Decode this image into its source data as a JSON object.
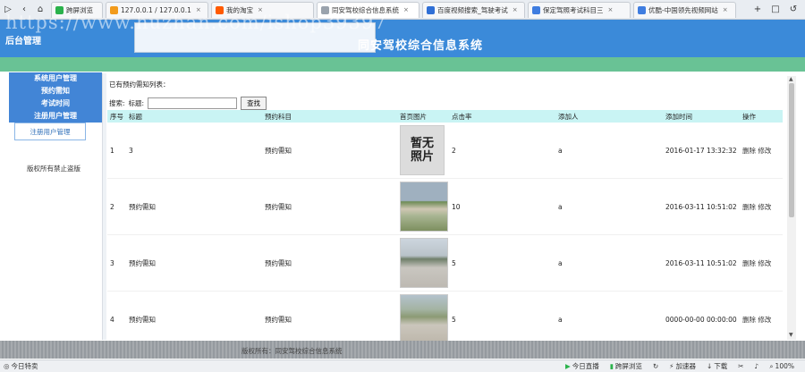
{
  "browser": {
    "tabs": [
      {
        "label": "跨屏浏览",
        "color": "#2bb24c",
        "active": false
      },
      {
        "label": "127.0.0.1 / 127.0.0.1",
        "color": "#f29b1c",
        "active": false
      },
      {
        "label": "我的淘宝",
        "color": "#ff5a00",
        "active": false
      },
      {
        "label": "同安驾校综合信息系统",
        "color": "#9aa3ad",
        "active": true
      },
      {
        "label": "百度视频搜索_驾驶考试",
        "color": "#2f6fd6",
        "active": false
      },
      {
        "label": "保定驾照考试科目三",
        "color": "#3f7de0",
        "active": false
      },
      {
        "label": "优酷-中国领先视频网站",
        "color": "#3f7de0",
        "active": false
      }
    ],
    "tools": [
      "+",
      "□",
      "↺"
    ]
  },
  "watermark": "https://www.huzhan.com/ishop39397",
  "header": {
    "admin_label": "后台管理",
    "system_title": "同安驾校综合信息系统"
  },
  "sidebar": {
    "main_items": [
      "系统用户管理",
      "预约需知",
      "考试时间",
      "注册用户管理"
    ],
    "sub_item": "注册用户管理",
    "copyright": "版权所有禁止盗版"
  },
  "main": {
    "list_title": "已有预约需知列表：",
    "search_prefix": "搜索:",
    "search_field_label": "标题:",
    "search_value": "",
    "search_button": "查找",
    "columns": [
      "序号",
      "标题",
      "预约科目",
      "首页图片",
      "点击率",
      "添加人",
      "添加时间",
      "操作"
    ],
    "rows": [
      {
        "no": "1",
        "title": "3",
        "category": "预约需知",
        "image": "none",
        "no_image_text": "暂无照片",
        "clicks": "2",
        "adder": "a",
        "time": "2016-01-17 13:32:32",
        "op_delete": "删除",
        "op_edit": "修改"
      },
      {
        "no": "2",
        "title": "预约需知",
        "category": "预约需知",
        "image": "photo1",
        "clicks": "10",
        "adder": "a",
        "time": "2016-03-11 10:51:02",
        "op_delete": "删除",
        "op_edit": "修改"
      },
      {
        "no": "3",
        "title": "预约需知",
        "category": "预约需知",
        "image": "photo2",
        "clicks": "5",
        "adder": "a",
        "time": "2016-03-11 10:51:02",
        "op_delete": "删除",
        "op_edit": "修改"
      },
      {
        "no": "4",
        "title": "预约需知",
        "category": "预约需知",
        "image": "photo3",
        "clicks": "5",
        "adder": "a",
        "time": "0000-00-00 00:00:00",
        "op_delete": "删除",
        "op_edit": "修改"
      }
    ]
  },
  "footer": {
    "text": "版权所有：同安驾校综合信息系统"
  },
  "statusbar": {
    "left": "今日特卖",
    "items": [
      "今日直播",
      "跨屏浏览",
      "加速器",
      "下载"
    ],
    "zoom": "100%"
  }
}
